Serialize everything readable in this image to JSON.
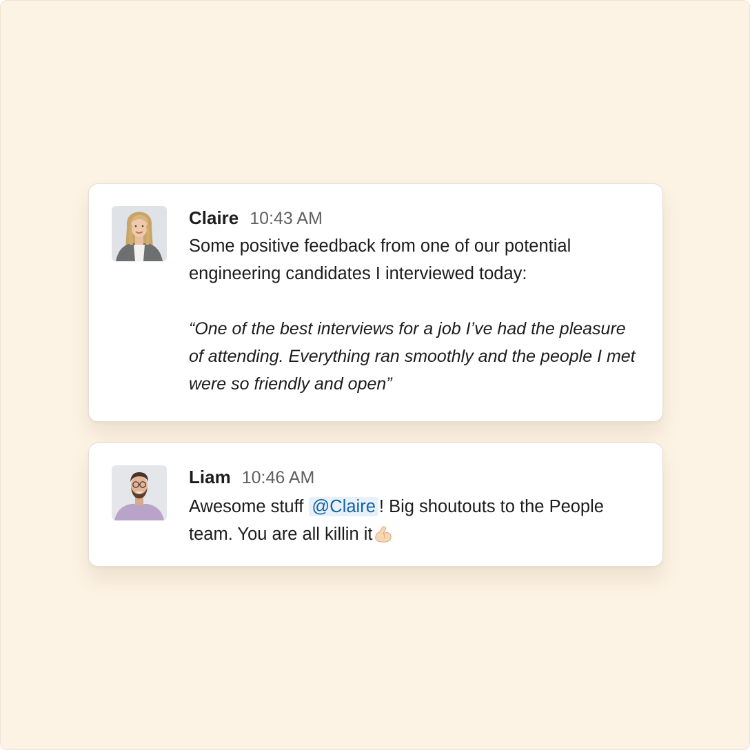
{
  "messages": [
    {
      "author": "Claire",
      "time": "10:43 AM",
      "body": "Some positive feedback from one of our potential engineering candidates I interviewed today:",
      "quote": "“One of the best interviews for a job I’ve had the pleasure of attending. Everything ran smoothly and the people I met were so friendly and open”",
      "avatar_icon": "user-photo-claire"
    },
    {
      "author": "Liam",
      "time": "10:46 AM",
      "body_before": "Awesome stuff ",
      "mention": "@Claire",
      "body_after": "! Big shoutouts to the People team. You are all killin it",
      "emoji_icon": "flexed-biceps-emoji",
      "avatar_icon": "user-photo-liam"
    }
  ],
  "colors": {
    "background": "#fdf3e4",
    "card": "#ffffff",
    "mention_text": "#1264a3",
    "mention_bg": "#e8f1fa",
    "timestamp": "#616061"
  }
}
